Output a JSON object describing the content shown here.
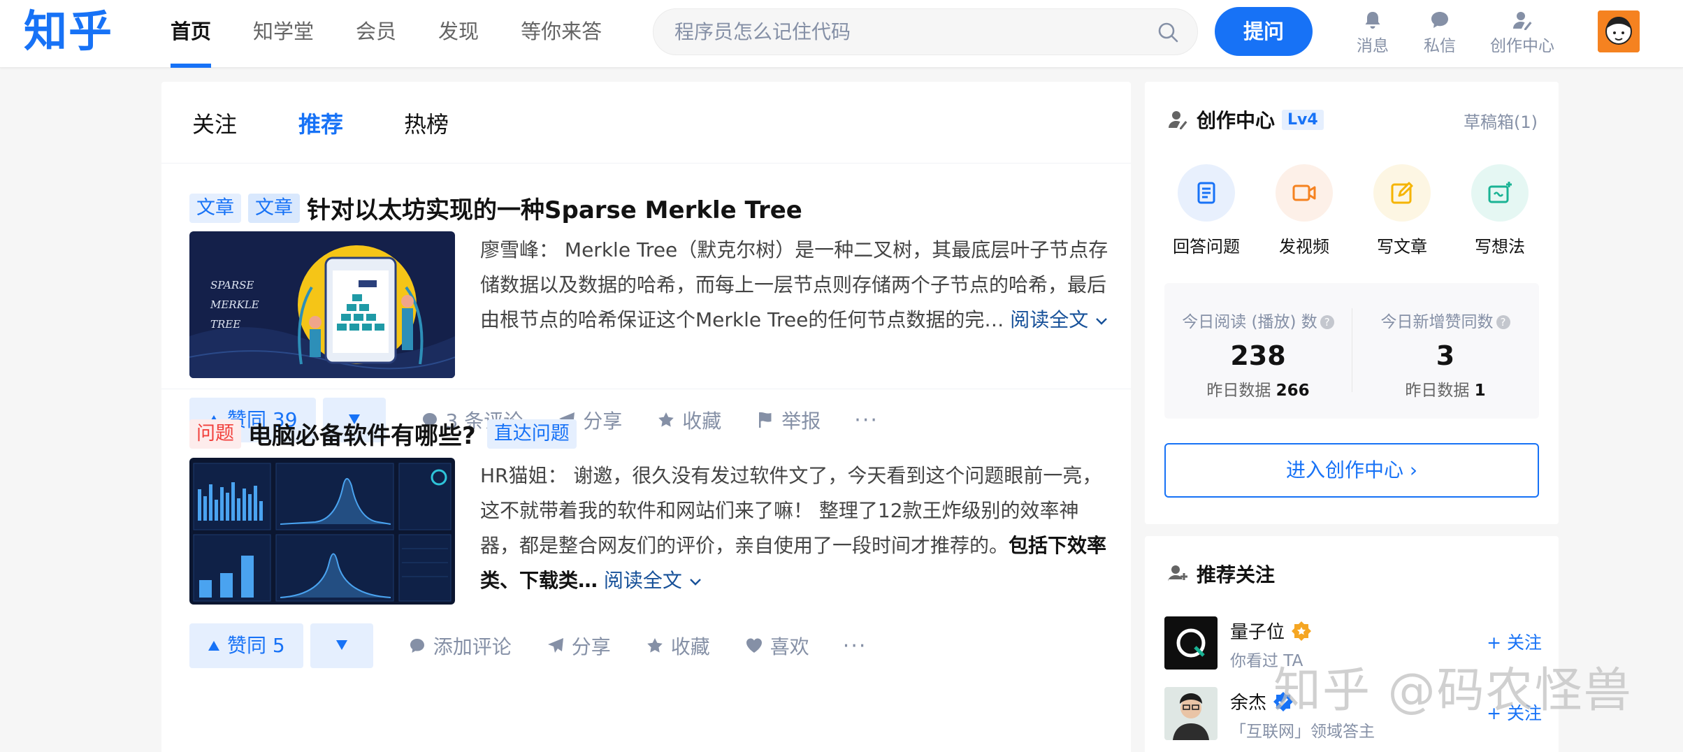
{
  "header": {
    "logo": "知乎",
    "nav": [
      "首页",
      "知学堂",
      "会员",
      "发现",
      "等你来答"
    ],
    "search_placeholder": "程序员怎么记住代码",
    "ask_label": "提问",
    "icons": [
      {
        "icon": "bell-icon",
        "label": "消息"
      },
      {
        "icon": "chat-icon",
        "label": "私信"
      },
      {
        "icon": "creator-icon",
        "label": "创作中心"
      }
    ]
  },
  "tabs": [
    "关注",
    "推荐",
    "热榜"
  ],
  "feed": [
    {
      "tags": [
        "文章",
        "文章"
      ],
      "title": "针对以太坊实现的一种Sparse Merkle Tree",
      "thumb_text": [
        "SPARSE",
        "MERKLE",
        "TREE"
      ],
      "author": "廖雪峰：",
      "excerpt": "Merkle Tree（默克尔树）是一种二叉树，其最底层叶子节点存储数据以及数据的哈希，而每上一层节点则存储两个子节点的哈希，最后由根节点的哈希保证这个Merkle Tree的任何节点数据的完…",
      "read_more": "阅读全文",
      "vote": "赞同 39",
      "actions": [
        "3 条评论",
        "分享",
        "收藏",
        "举报"
      ],
      "more": "···"
    },
    {
      "tag": "问题",
      "title": "电脑必备软件有哪些?",
      "direct_tag": "直达问题",
      "author": "HR猫姐：",
      "excerpt": "谢邀，很久没有发过软件文了，今天看到这个问题眼前一亮，这不就带着我的软件和网站们来了嘛！ 整理了12款王炸级别的效率神器，都是整合网友们的评价，亲自使用了一段时间才推荐的。",
      "excerpt_bold": "包括下效率类、下载类…",
      "read_more": "阅读全文",
      "vote": "赞同 5",
      "actions": [
        "添加评论",
        "分享",
        "收藏",
        "喜欢"
      ],
      "more": "···"
    }
  ],
  "creator": {
    "title": "创作中心",
    "level": "Lv4",
    "drafts": "草稿箱(1)",
    "quick": [
      {
        "label": "回答问题",
        "icon": "answer-icon",
        "bg": "#e8f0fd",
        "color": "#1772f6"
      },
      {
        "label": "发视频",
        "icon": "video-icon",
        "bg": "#fdf0e8",
        "color": "#f58220"
      },
      {
        "label": "写文章",
        "icon": "write-icon",
        "bg": "#fdf6e3",
        "color": "#f5b400"
      },
      {
        "label": "写想法",
        "icon": "idea-icon",
        "bg": "#e5f7f3",
        "color": "#1ab394"
      }
    ],
    "stats": [
      {
        "label": "今日阅读 (播放) 数",
        "value": "238",
        "prev_label": "昨日数据",
        "prev_value": "266"
      },
      {
        "label": "今日新增赞同数",
        "value": "3",
        "prev_label": "昨日数据",
        "prev_value": "1"
      }
    ],
    "enter": "进入创作中心 ›"
  },
  "recommend": {
    "title": "推荐关注",
    "users": [
      {
        "name": "量子位",
        "sub": "你看过 TA",
        "follow": "+ 关注"
      },
      {
        "name": "余杰",
        "sub": "「互联网」领域答主",
        "follow": "+ 关注"
      }
    ]
  },
  "watermark": "知乎 @码农怪兽"
}
